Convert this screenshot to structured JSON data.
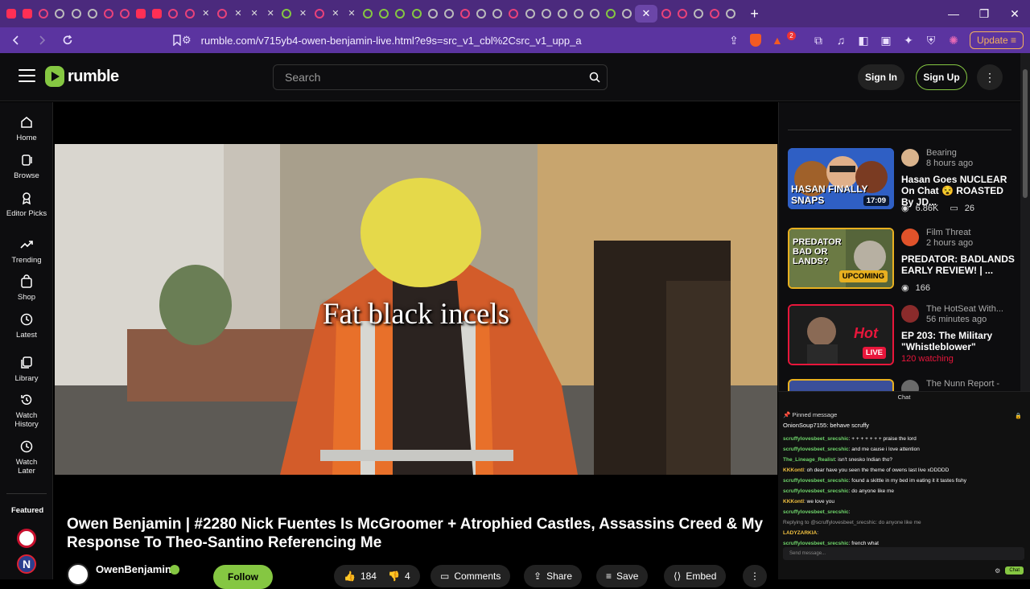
{
  "browser": {
    "url": "rumble.com/v715yb4-owen-benjamin-live.html?e9s=src_v1_cbl%2Csrc_v1_upp_a",
    "update_label": "Update",
    "tabs": [
      "yt",
      "yt",
      "pink",
      "grey",
      "grey",
      "grey",
      "pink",
      "pink",
      "yt",
      "yt",
      "pink",
      "pink",
      "x",
      "pink",
      "x",
      "x",
      "x",
      "rumble",
      "x",
      "pink",
      "x",
      "x",
      "rumble",
      "rumble",
      "rumble",
      "rumble",
      "grey",
      "grey",
      "pink",
      "grey",
      "grey",
      "pink",
      "grey",
      "grey",
      "grey",
      "grey",
      "grey",
      "rumble",
      "grey",
      "active",
      "pink",
      "pink",
      "grey",
      "pink",
      "grey"
    ],
    "new_tab": "+",
    "window_controls": [
      "—",
      "❐",
      "✕"
    ],
    "brave_count": "2"
  },
  "header": {
    "logo_text": "rumble",
    "search_placeholder": "Search",
    "signin_label": "Sign In",
    "signup_label": "Sign Up"
  },
  "sidebar": {
    "items": [
      {
        "label": "Home",
        "icon": "home-icon"
      },
      {
        "label": "Browse",
        "icon": "browse-icon"
      },
      {
        "label": "Editor Picks",
        "icon": "editor-picks-icon"
      },
      {
        "label": "Trending",
        "icon": "trending-icon"
      },
      {
        "label": "Shop",
        "icon": "shop-icon"
      },
      {
        "label": "Latest",
        "icon": "clock-icon"
      },
      {
        "label": "Library",
        "icon": "library-icon"
      },
      {
        "label": "Watch History",
        "icon": "history-icon"
      },
      {
        "label": "Watch Later",
        "icon": "watch-later-icon"
      }
    ],
    "featured_label": "Featured"
  },
  "video": {
    "caption": "Fat black incels",
    "title": "Owen Benjamin | #2280 Nick Fuentes Is McGroomer + Atrophied Castles, Assassins Creed & My Response To Theo-Santino Referencing Me",
    "channel": "OwenBenjamin",
    "follow_label": "Follow",
    "likes": "184",
    "dislikes": "4",
    "comments_label": "Comments",
    "share_label": "Share",
    "save_label": "Save",
    "embed_label": "Embed"
  },
  "recommendations": [
    {
      "channel": "Bearing",
      "time": "8 hours ago",
      "title": "Hasan Goes NUCLEAR On Chat 😵 ROASTED By JD...",
      "views": "6.86K",
      "comments": "26",
      "duration": "17:09",
      "thumb_text": "HASAN FINALLY SNAPS",
      "thumb_color": "#c23a2a",
      "avatar_color": "#d9b38c"
    },
    {
      "channel": "Film Threat",
      "time": "2 hours ago",
      "title": "PREDATOR: BADLANDS EARLY REVIEW! | ...",
      "views": "166",
      "badge": "UPCOMING",
      "thumb_text": "PREDATOR BAD OR LANDS?",
      "thumb_color": "#5a6b3a",
      "avatar_color": "#e0522a"
    },
    {
      "channel": "The HotSeat With...",
      "time": "56 minutes ago",
      "title": "EP 203: The Military \"Whistleblower\"",
      "watching": "120 watching",
      "badge": "LIVE",
      "thumb_text": "",
      "thumb_color": "#1a1a1a",
      "avatar_color": "#8a2b2b"
    },
    {
      "channel": "The Nunn Report - w...",
      "time": "",
      "title": "",
      "thumb_text": "",
      "thumb_color": "#3a4f9a",
      "avatar_color": "#6a6a6a"
    }
  ],
  "chat": {
    "header": "Chat",
    "pinned_label": "Pinned message",
    "pinned_text": "OnionSoup7155: behave scruffy",
    "lines": [
      {
        "user": "scruffylovesbeet_srecshic",
        "text": "+ + + + + + + praise the lord"
      },
      {
        "user": "scruffylovesbeet_srecshic",
        "text": "and me cause i love attention"
      },
      {
        "user": "The_Lineage_Realist",
        "text": "isn't snesko Indian tho?"
      },
      {
        "user": "KKKontl",
        "text": "oh dear have you seen the theme of owens last live xDDDDD"
      },
      {
        "user": "scruffylovesbeet_srecshic",
        "text": "found a skittle in my bed im eating it it tastes fishy"
      },
      {
        "user": "scruffylovesbeet_srecshic",
        "text": "do anyone like me"
      },
      {
        "user": "KKKontl",
        "text": "we love you"
      },
      {
        "user": "scruffylovesbeet_srecshic",
        "text": ""
      },
      {
        "user": "",
        "text": "Replying to @scruffylovesbeet_srecshic: do anyone like me"
      },
      {
        "user": "LADYZARKIA",
        "text": ""
      },
      {
        "user": "scruffylovesbeet_srecshic",
        "text": "french what"
      }
    ],
    "input_placeholder": "Send message...",
    "send_label": "Chat"
  }
}
